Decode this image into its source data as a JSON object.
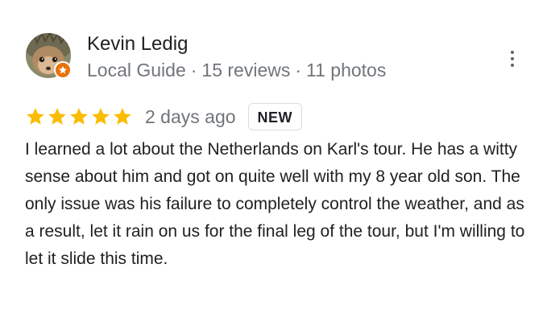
{
  "reviewer": {
    "name": "Kevin Ledig",
    "level": "Local Guide",
    "reviews": "15 reviews",
    "photos": "11 photos",
    "separator": "·",
    "avatar_icon": "hedgehog-avatar",
    "badge_icon": "local-guide-star-icon",
    "badge_color": "#e8710a"
  },
  "menu": {
    "icon": "more-vert-icon"
  },
  "review": {
    "rating": 5,
    "max_rating": 5,
    "star_color": "#fbbc04",
    "age": "2 days ago",
    "badge": "NEW",
    "text": "I learned a lot about the Netherlands on Karl's tour. He has a witty sense about him and got on quite well with my 8 year old son. The only issue was his failure to completely control the weather, and as a result, let it rain on us for the final leg of the tour, but I'm willing to let it slide this time."
  }
}
